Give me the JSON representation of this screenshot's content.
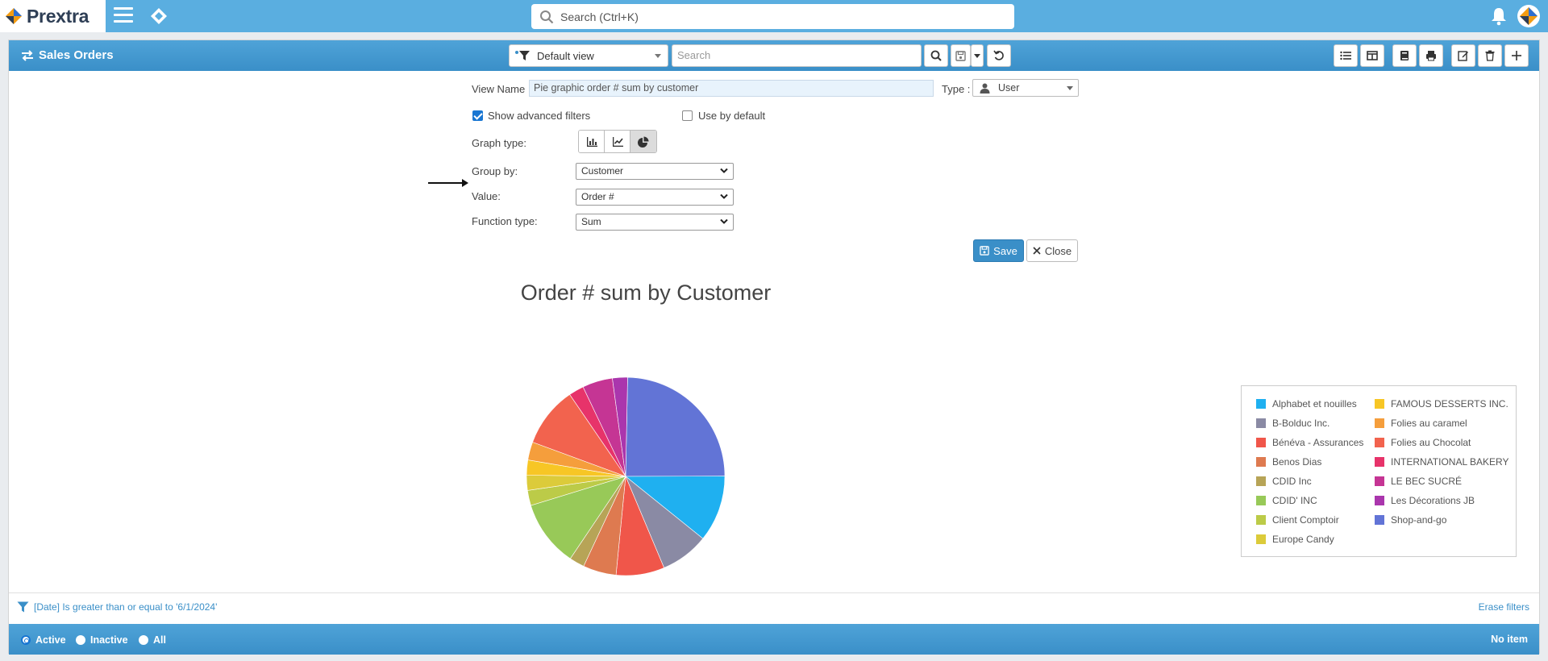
{
  "app": {
    "name": "Prextra",
    "search_placeholder": "Search (Ctrl+K)"
  },
  "panel": {
    "title": "Sales Orders",
    "view_select": "Default view",
    "search_placeholder": "Search"
  },
  "form": {
    "view_name_label": "View Name :",
    "view_name_value": "Pie graphic order # sum by customer",
    "type_label": "Type :",
    "type_value": "User",
    "show_advanced_filters": "Show advanced filters",
    "use_by_default": "Use by default",
    "graph_type_label": "Graph type:",
    "group_by_label": "Group by:",
    "group_by_value": "Customer",
    "value_label": "Value:",
    "value_value": "Order #",
    "function_type_label": "Function type:",
    "function_type_value": "Sum",
    "save_label": "Save",
    "close_label": "Close"
  },
  "chart_data": {
    "type": "pie",
    "title": "Order # sum by Customer",
    "legend_position": "right",
    "slices": [
      {
        "label": "Shop-and-go",
        "value": 25,
        "color": "#6274d6"
      },
      {
        "label": "Alphabet et nouilles",
        "value": 11,
        "color": "#1fb0f0"
      },
      {
        "label": "B-Bolduc Inc.",
        "value": 8,
        "color": "#8a8aa4"
      },
      {
        "label": "Bénéva - Assurances",
        "value": 8,
        "color": "#f0564a"
      },
      {
        "label": "Benos Dias",
        "value": 5.5,
        "color": "#de7a50"
      },
      {
        "label": "CDID Inc",
        "value": 2.5,
        "color": "#b7a457"
      },
      {
        "label": "CDID' INC",
        "value": 11,
        "color": "#98c958"
      },
      {
        "label": "Client Comptoir",
        "value": 2.5,
        "color": "#bccb48"
      },
      {
        "label": "Europe Candy",
        "value": 2.5,
        "color": "#dccb3a"
      },
      {
        "label": "FAMOUS DESSERTS INC.",
        "value": 2.5,
        "color": "#f7c625"
      },
      {
        "label": "Folies au caramel",
        "value": 3,
        "color": "#f59e3c"
      },
      {
        "label": "Folies au Chocolat",
        "value": 10,
        "color": "#f2634e"
      },
      {
        "label": "INTERNATIONAL BAKERY",
        "value": 2.5,
        "color": "#e7336a"
      },
      {
        "label": "LE BEC SUCRÉ",
        "value": 5,
        "color": "#c53594"
      },
      {
        "label": "Les Décorations JB",
        "value": 2.5,
        "color": "#aa36ad"
      }
    ]
  },
  "legend_col1": [
    {
      "label": "Alphabet et nouilles",
      "color": "#1fb0f0"
    },
    {
      "label": "B-Bolduc Inc.",
      "color": "#8a8aa4"
    },
    {
      "label": "Bénéva - Assurances",
      "color": "#f0564a"
    },
    {
      "label": "Benos Dias",
      "color": "#de7a50"
    },
    {
      "label": "CDID Inc",
      "color": "#b7a457"
    },
    {
      "label": "CDID' INC",
      "color": "#98c958"
    },
    {
      "label": "Client Comptoir",
      "color": "#bccb48"
    },
    {
      "label": "Europe Candy",
      "color": "#dccb3a"
    }
  ],
  "legend_col2": [
    {
      "label": "FAMOUS DESSERTS INC.",
      "color": "#f7c625"
    },
    {
      "label": "Folies au caramel",
      "color": "#f59e3c"
    },
    {
      "label": "Folies au Chocolat",
      "color": "#f2634e"
    },
    {
      "label": "INTERNATIONAL BAKERY",
      "color": "#e7336a"
    },
    {
      "label": "LE BEC SUCRÉ",
      "color": "#c53594"
    },
    {
      "label": "Les Décorations JB",
      "color": "#aa36ad"
    },
    {
      "label": "Shop-and-go",
      "color": "#6274d6"
    }
  ],
  "filter": {
    "text": "[Date] Is greater than or equal to '6/1/2024'",
    "erase": "Erase filters"
  },
  "footer": {
    "active": "Active",
    "inactive": "Inactive",
    "all": "All",
    "count": "No item"
  }
}
